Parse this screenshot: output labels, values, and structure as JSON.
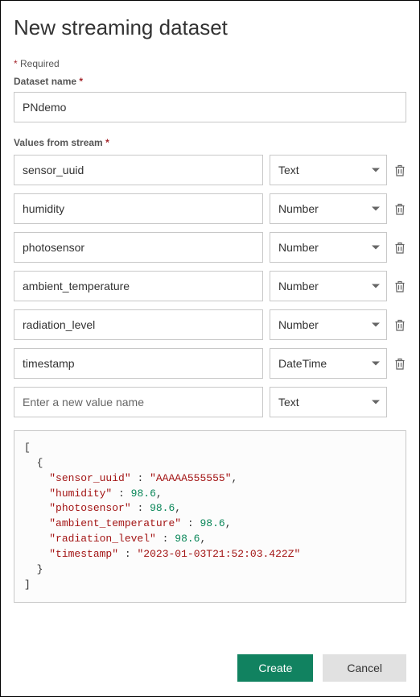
{
  "title": "New streaming dataset",
  "required_note": "Required",
  "labels": {
    "dataset_name": "Dataset name",
    "values_from_stream": "Values from stream"
  },
  "dataset_name_value": "PNdemo",
  "value_rows": [
    {
      "name": "sensor_uuid",
      "type": "Text"
    },
    {
      "name": "humidity",
      "type": "Number"
    },
    {
      "name": "photosensor",
      "type": "Number"
    },
    {
      "name": "ambient_temperature",
      "type": "Number"
    },
    {
      "name": "radiation_level",
      "type": "Number"
    },
    {
      "name": "timestamp",
      "type": "DateTime"
    }
  ],
  "new_value_placeholder": "Enter a new value name",
  "new_value_type": "Text",
  "type_options": [
    "Text",
    "Number",
    "DateTime"
  ],
  "json_preview": {
    "sensor_uuid": "AAAAA555555",
    "humidity": 98.6,
    "photosensor": 98.6,
    "ambient_temperature": 98.6,
    "radiation_level": 98.6,
    "timestamp": "2023-01-03T21:52:03.422Z"
  },
  "buttons": {
    "create": "Create",
    "cancel": "Cancel"
  }
}
